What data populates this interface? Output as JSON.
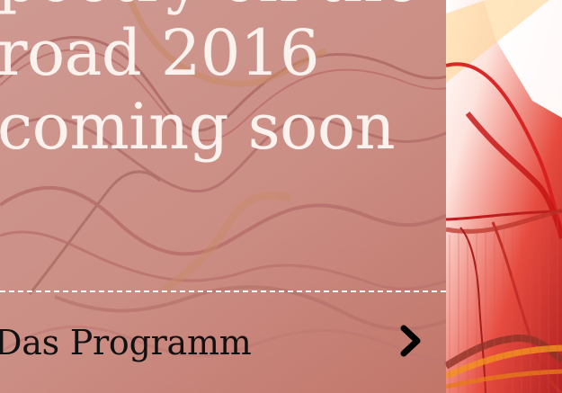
{
  "hero": {
    "headline_lines": [
      "poetry on the",
      "road 2016",
      "coming soon"
    ],
    "panel_color": "#b97b73",
    "text_color": "#fbf2ee"
  },
  "navigation": {
    "program_label": "Das Programm",
    "chevron_icon": "chevron-right-icon"
  },
  "colors": {
    "art_red": "#c72727",
    "art_orange": "#e88924",
    "art_light": "#fff8f4"
  }
}
